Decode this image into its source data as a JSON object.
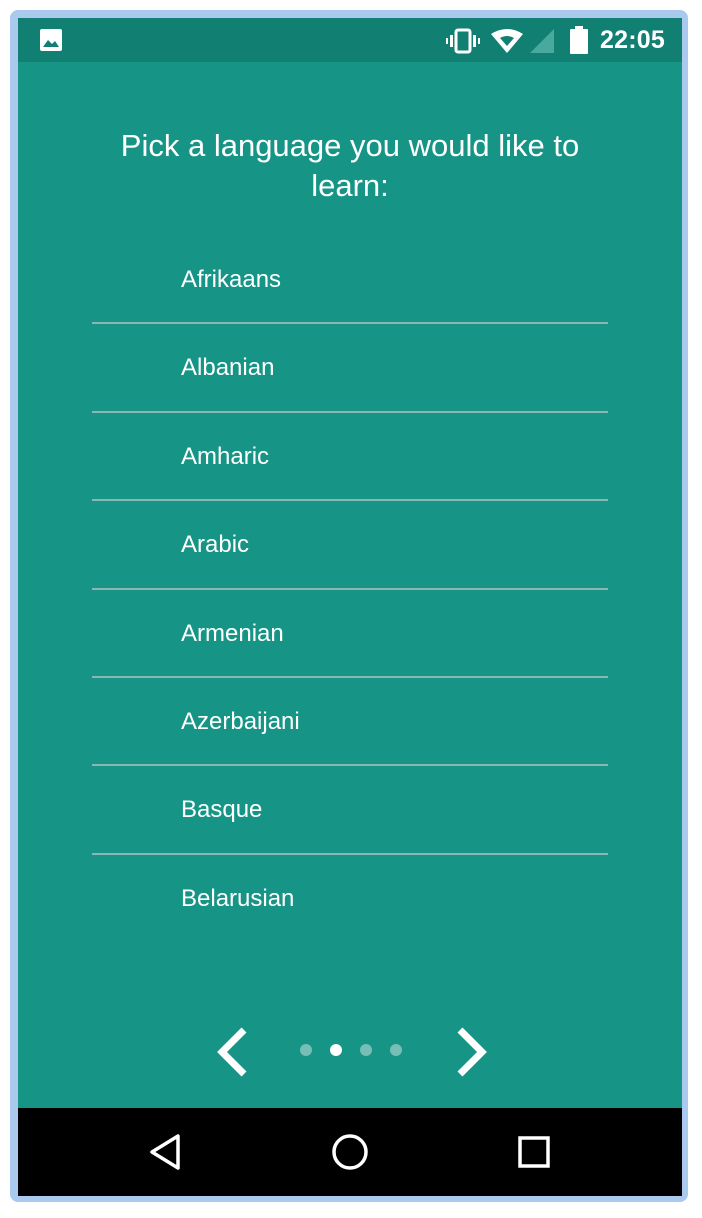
{
  "status_bar": {
    "time": "22:05",
    "icons": [
      "gallery-icon",
      "vibrate-icon",
      "wifi-icon",
      "signal-icon",
      "battery-icon"
    ]
  },
  "title": "Pick a language you would like to learn:",
  "languages": [
    "Afrikaans",
    "Albanian",
    "Amharic",
    "Arabic",
    "Armenian",
    "Azerbaijani",
    "Basque",
    "Belarusian"
  ],
  "pager": {
    "page_count": 4,
    "active_page": 2,
    "prev_icon": "chevron-left-icon",
    "next_icon": "chevron-right-icon"
  },
  "nav_bar": {
    "icons": [
      "back-triangle-icon",
      "home-circle-icon",
      "recents-square-icon"
    ]
  },
  "colors": {
    "background": "#169587",
    "status_bar": "#127f73",
    "divider": "#89b8b2",
    "text": "#ffffff",
    "nav_bar": "#000000"
  }
}
